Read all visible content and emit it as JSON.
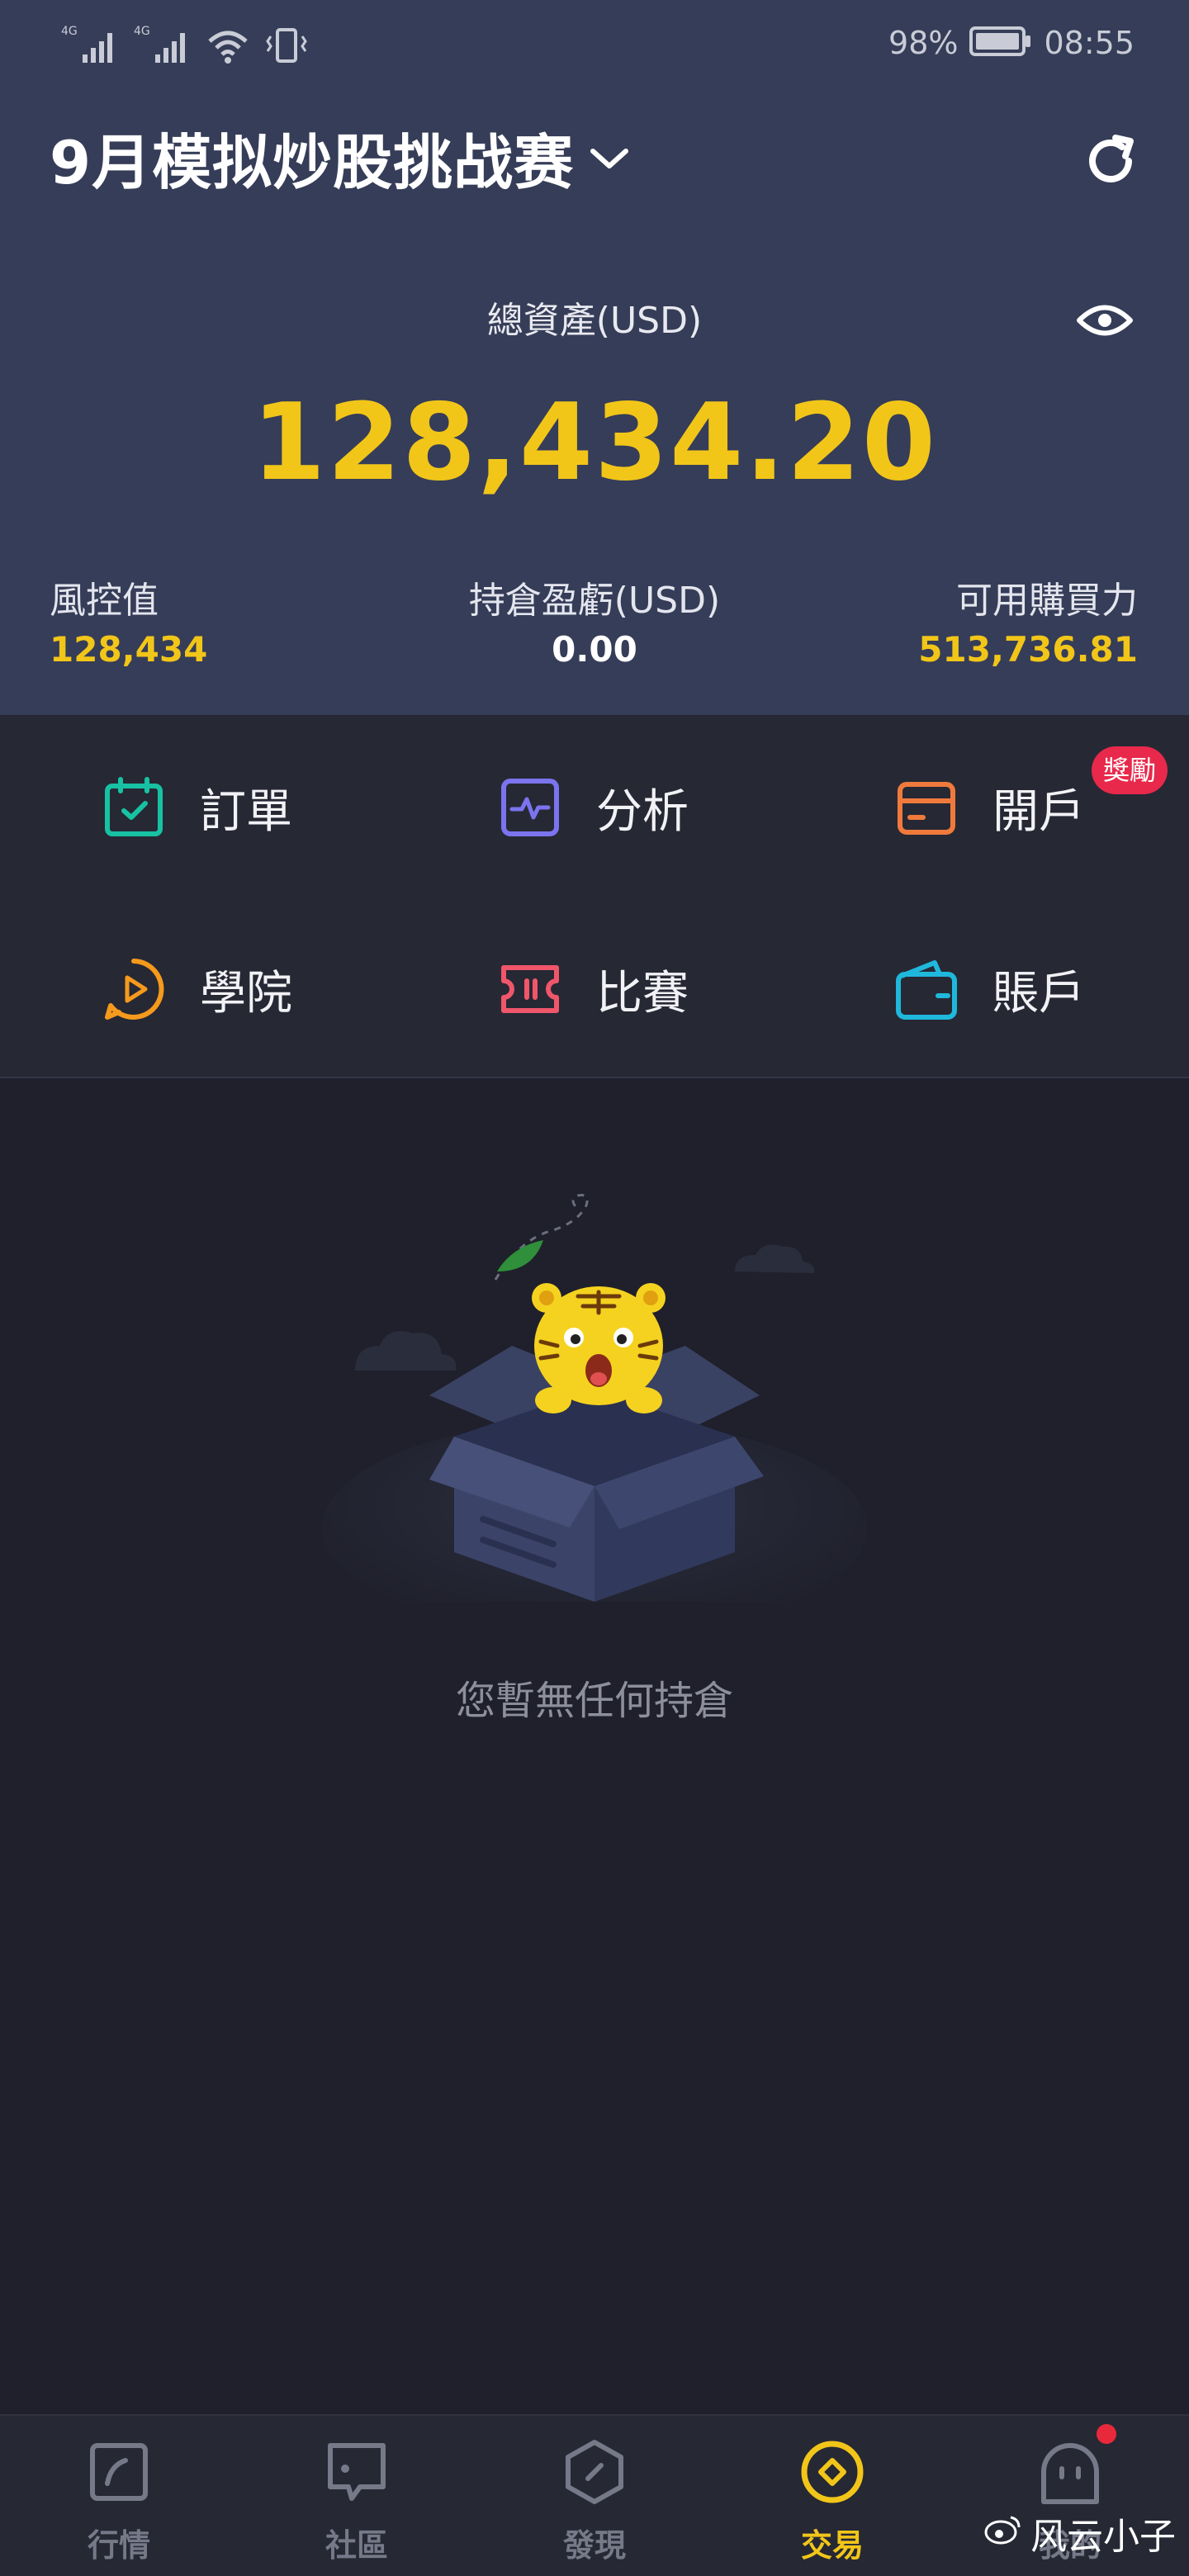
{
  "status_bar": {
    "network_1": "4G",
    "network_2": "4G",
    "battery": "98%",
    "time": "08:55"
  },
  "header": {
    "contest_title": "9月模拟炒股挑战赛",
    "total_assets_label": "總資產(USD)",
    "total_assets_value": "128,434.20"
  },
  "stats": {
    "risk_label": "風控值",
    "risk_value": "128,434",
    "pnl_label": "持倉盈虧(USD)",
    "pnl_value": "0.00",
    "buying_power_label": "可用購買力",
    "buying_power_value": "513,736.81"
  },
  "menu": {
    "orders": "訂單",
    "analysis": "分析",
    "open_account": "開戶",
    "open_account_badge": "獎勵",
    "academy": "學院",
    "contest": "比賽",
    "account": "賬戶"
  },
  "empty_state": {
    "message": "您暫無任何持倉"
  },
  "bottom_nav": {
    "market": "行情",
    "community": "社區",
    "discover": "發現",
    "trade": "交易",
    "me": "我的"
  },
  "watermark": "风云小子",
  "colors": {
    "header_bg": "#363d58",
    "body_bg": "#1f202b",
    "menu_bg": "#262834",
    "accent_yellow": "#f2c619",
    "badge_red": "#e8294b"
  },
  "icons": {
    "orders": "calendar-check-icon",
    "analysis": "pulse-chart-icon",
    "open_account": "card-icon",
    "academy": "play-circle-icon",
    "contest": "ticket-icon",
    "account": "wallet-icon"
  }
}
